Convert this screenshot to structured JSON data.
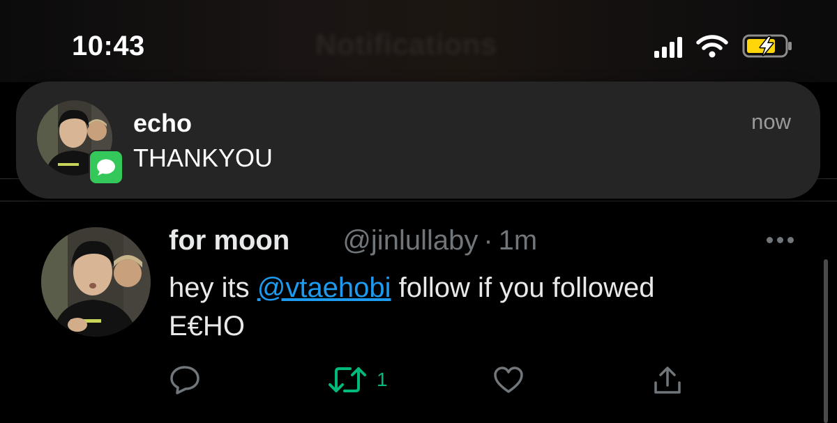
{
  "status_bar": {
    "time": "10:43",
    "icons": [
      "cellular-signal-icon",
      "wifi-icon",
      "battery-charging-icon"
    ]
  },
  "header": {
    "title": "Notifications"
  },
  "notification": {
    "app_icon": "messages-icon",
    "sender": "echo",
    "sender_emoji": "crescent-moon-icon",
    "message": "THANKYOU",
    "time": "now"
  },
  "tweet": {
    "display_name": "for moon",
    "name_emoji": "crescent-moon-icon",
    "handle": "@jinlullaby",
    "separator": "·",
    "time": "1m",
    "text_before": "hey its ",
    "mention": "@vtaehobi",
    "text_after": " follow if you followed",
    "text_line2": "E€HO",
    "actions": {
      "reply_icon": "reply-icon",
      "retweet_icon": "retweet-icon",
      "retweet_count": "1",
      "retweet_active": true,
      "like_icon": "heart-icon",
      "share_icon": "share-icon"
    }
  },
  "colors": {
    "background": "#000000",
    "notification_bg": "#252525",
    "mention": "#1d9bf0",
    "retweet_active": "#00ba7c",
    "secondary_text": "#71767b",
    "battery_charging": "#ffd60a",
    "messages_green": "#34c759"
  }
}
